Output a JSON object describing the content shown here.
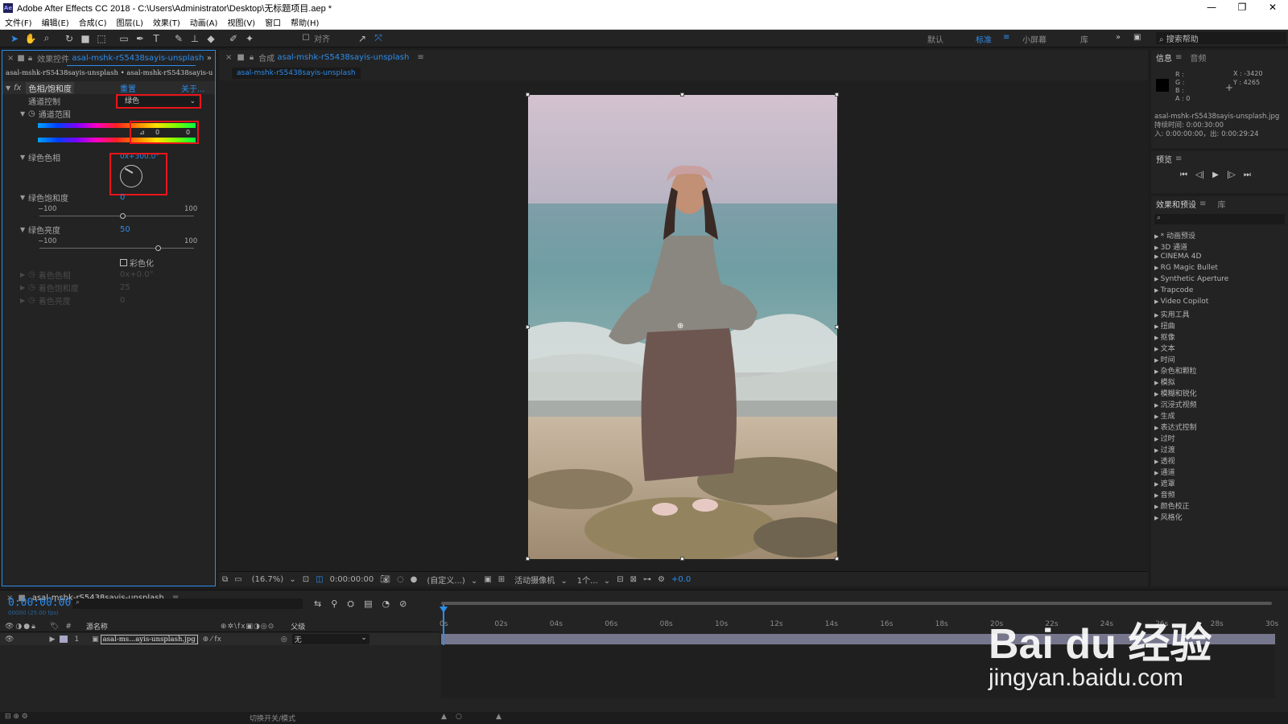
{
  "window": {
    "title": "Adobe After Effects CC 2018 - C:\\Users\\Administrator\\Desktop\\无标题项目.aep *",
    "app_icon": "Ae",
    "minimize": "—",
    "maximize": "❐",
    "close": "✕"
  },
  "menu": [
    "文件(F)",
    "编辑(E)",
    "合成(C)",
    "图层(L)",
    "效果(T)",
    "动画(A)",
    "视图(V)",
    "窗口",
    "帮助(H)"
  ],
  "toolbar": {
    "align_label": "对齐",
    "workspaces": [
      "默认",
      "标准",
      "小屏幕",
      "库"
    ],
    "active_workspace": "标准",
    "more": "»",
    "search_placeholder": "搜索帮助"
  },
  "effect_controls": {
    "tab_prefix": "效果控件",
    "tab_layer": "asal-mshk-rS5438sayis-unsplash",
    "breadcrumb": "asal-mshk-rS5438sayis-unsplash • asal-mshk-rS5438sayis-u",
    "effect_name": "色相/饱和度",
    "reset": "重置",
    "about": "关于...",
    "channel_control_label": "通道控制",
    "channel_control_value": "绿色",
    "channel_range_label": "通道范围",
    "range_val1": "0",
    "range_val2": "0",
    "hue_label": "绿色色相",
    "hue_value": "0x+300.0°",
    "saturation_label": "绿色饱和度",
    "saturation_value": "0",
    "saturation_min": "−100",
    "saturation_max": "100",
    "lightness_label": "绿色亮度",
    "lightness_value": "50",
    "lightness_min": "−100",
    "lightness_max": "100",
    "colorize_label": "彩色化",
    "colorize_hue_label": "着色色相",
    "colorize_hue_value": "0x+0.0°",
    "colorize_sat_label": "着色饱和度",
    "colorize_sat_value": "25",
    "colorize_light_label": "着色亮度",
    "colorize_light_value": "0"
  },
  "composition": {
    "tab_prefix": "合成",
    "tab_name": "asal-mshk-rS5438sayis-unsplash",
    "subtab": "asal-mshk-rS5438sayis-unsplash",
    "zoom": "(16.7%)",
    "timecode": "0:00:00:00",
    "resolution": "(自定义...)",
    "camera": "活动摄像机",
    "views": "1个...",
    "exposure": "+0.0"
  },
  "info": {
    "tab": "信息",
    "tab2": "音频",
    "r": "R :",
    "g": "G :",
    "b": "B :",
    "a": "A : 0",
    "x": "X : -3420",
    "y": "Y : 4265",
    "filename": "asal-mshk-rS5438sayis-unsplash.jpg",
    "duration": "持续时间: 0:00:30:00",
    "inout": "入: 0:00:00:00，出: 0:00:29:24"
  },
  "preview": {
    "tab": "预览"
  },
  "effects_presets": {
    "tab": "效果和预设",
    "tab2": "库",
    "items": [
      "* 动画预设",
      "3D 通道",
      "CINEMA 4D",
      "RG Magic Bullet",
      "Synthetic Aperture",
      "Trapcode",
      "Video Copilot",
      "实用工具",
      "扭曲",
      "抠像",
      "文本",
      "时间",
      "杂色和颗粒",
      "模拟",
      "模糊和锐化",
      "沉浸式视频",
      "生成",
      "表达式控制",
      "过时",
      "过渡",
      "透视",
      "通道",
      "遮罩",
      "音频",
      "颜色校正",
      "风格化"
    ]
  },
  "timeline": {
    "comp_name": "asal-mshk-rS5438sayis-unsplash",
    "timecode": "0:00:00:00",
    "timecode_sub": "00000 (25.00 fps)",
    "col_source": "源名称",
    "col_parent": "父级",
    "layer_num": "1",
    "layer_name": "asal-ms...ayis-unsplash.jpg",
    "parent_value": "无",
    "ticks": [
      "0s",
      "02s",
      "04s",
      "06s",
      "08s",
      "10s",
      "12s",
      "14s",
      "16s",
      "18s",
      "20s",
      "22s",
      "24s",
      "26s",
      "28s",
      "30s"
    ],
    "switch_mode": "切换开关/模式"
  },
  "watermark": {
    "brand": "Bai du 经验",
    "url": "jingyan.baidu.com"
  }
}
